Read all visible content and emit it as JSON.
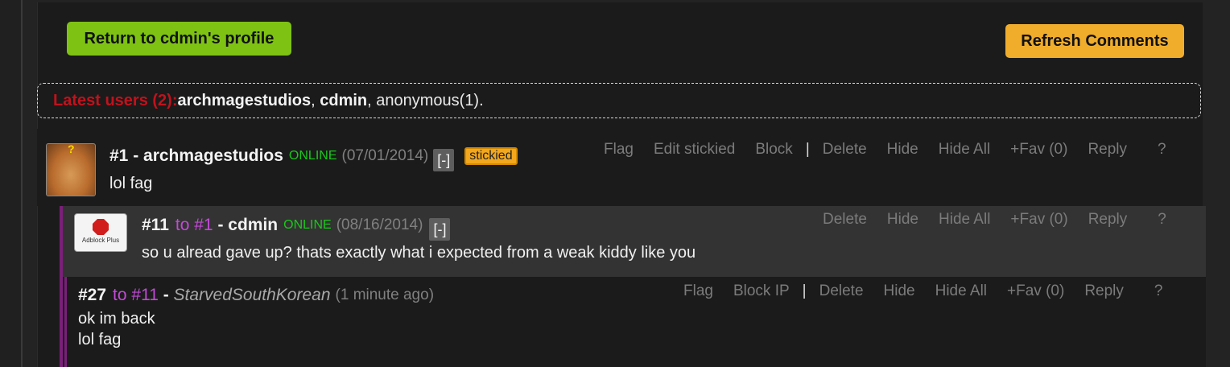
{
  "header": {
    "return_label": "Return to cdmin's profile",
    "refresh_label": "Refresh Comments"
  },
  "latest": {
    "label": "Latest users (2):",
    "user1": "archmagestudios",
    "sep1": ", ",
    "user2": "cdmin",
    "rest": ", anonymous(1)."
  },
  "comments": [
    {
      "num": "#1",
      "dash": " - ",
      "author": "archmagestudios",
      "status": "ONLINE",
      "date": "(07/01/2014)",
      "collapse": "[-]",
      "badge": "stickied",
      "body": "lol fag",
      "actions": [
        "Flag",
        "Edit stickied",
        "Block",
        "|",
        "Delete",
        "Hide",
        "Hide All",
        "+Fav (0)",
        "Reply",
        "?"
      ]
    },
    {
      "num": "#11",
      "to": "to #1",
      "dash": " - ",
      "author": "cdmin",
      "status": "ONLINE",
      "date": "(08/16/2014)",
      "collapse": "[-]",
      "avatar_text": "Adblock Plus",
      "body": "so u alread gave up? thats exactly what i expected from a weak kiddy like you",
      "actions": [
        "Delete",
        "Hide",
        "Hide All",
        "+Fav (0)",
        "Reply",
        "?"
      ]
    },
    {
      "num": "#27",
      "to": "to #11",
      "dash": " - ",
      "author": "StarvedSouthKorean",
      "date": "(1 minute ago)",
      "body_line1": "ok im back",
      "body_line2": "lol fag",
      "actions": [
        "Flag",
        "Block IP",
        "|",
        "Delete",
        "Hide",
        "Hide All",
        "+Fav (0)",
        "Reply",
        "?"
      ]
    }
  ],
  "icons": {
    "avatar1": "cat-avatar-icon",
    "avatar2": "adblock-plus-avatar-icon"
  },
  "colors": {
    "return_button": "#7ec213",
    "refresh_button": "#f0ad2c",
    "latest_label": "#c1121c",
    "online": "#19c819",
    "reply_to": "#c24ad6",
    "thread_bar": "#7a1f7a"
  }
}
